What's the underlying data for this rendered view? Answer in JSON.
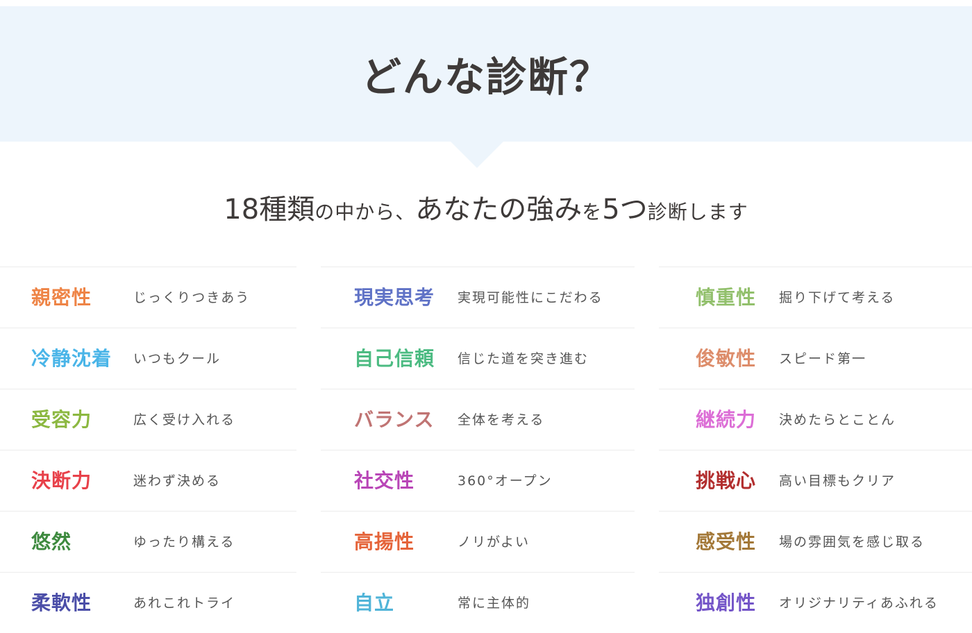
{
  "header": {
    "title": "どんな診断？"
  },
  "intro": {
    "part1": "18種類",
    "part2": "の中から、",
    "part3": "あなたの強み",
    "part4": "を",
    "part5": "5つ",
    "part6": "診断します"
  },
  "columns": [
    {
      "items": [
        {
          "label": "親密性",
          "desc": "じっくりつきあう",
          "color": "#ee8446"
        },
        {
          "label": "冷静沈着",
          "desc": "いつもクール",
          "color": "#4ab5e8"
        },
        {
          "label": "受容力",
          "desc": "広く受け入れる",
          "color": "#8cb841"
        },
        {
          "label": "決断力",
          "desc": "迷わず決める",
          "color": "#e8414a"
        },
        {
          "label": "悠然",
          "desc": "ゆったり構える",
          "color": "#3e8a3f"
        },
        {
          "label": "柔軟性",
          "desc": "あれこれトライ",
          "color": "#4b4ea8"
        }
      ]
    },
    {
      "items": [
        {
          "label": "現実思考",
          "desc": "実現可能性にこだわる",
          "color": "#5f72c6"
        },
        {
          "label": "自己信頼",
          "desc": "信じた道を突き進む",
          "color": "#4cbb82"
        },
        {
          "label": "バランス",
          "desc": "全体を考える",
          "color": "#c07473"
        },
        {
          "label": "社交性",
          "desc": "360°オープン",
          "color": "#b946b7"
        },
        {
          "label": "高揚性",
          "desc": "ノリがよい",
          "color": "#e5643a"
        },
        {
          "label": "自立",
          "desc": "常に主体的",
          "color": "#50b4d8"
        }
      ]
    },
    {
      "items": [
        {
          "label": "慎重性",
          "desc": "掘り下げて考える",
          "color": "#92c06c"
        },
        {
          "label": "俊敏性",
          "desc": "スピード第一",
          "color": "#dd8d6b"
        },
        {
          "label": "継続力",
          "desc": "決めたらとことん",
          "color": "#dc6ed6"
        },
        {
          "label": "挑戦心",
          "desc": "高い目標もクリア",
          "color": "#b22e2e"
        },
        {
          "label": "感受性",
          "desc": "場の雰囲気を感じ取る",
          "color": "#a37838"
        },
        {
          "label": "独創性",
          "desc": "オリジナリティあふれる",
          "color": "#7455c8"
        }
      ]
    }
  ]
}
